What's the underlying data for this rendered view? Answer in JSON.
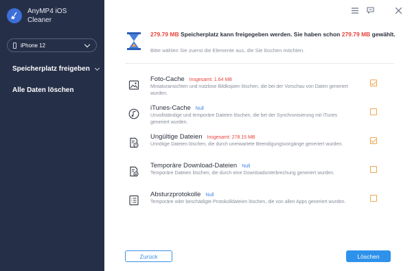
{
  "app": {
    "name": "AnyMP4 iOS Cleaner"
  },
  "device": {
    "name": "iPhone 12"
  },
  "sidebar": {
    "items": [
      {
        "label": "Speicherplatz freigeben"
      },
      {
        "label": "Alle Daten löschen"
      }
    ]
  },
  "header": {
    "size_a": "279.79 MB",
    "text_a": " Speicherplatz kann freigegeben werden. Sie haben schon ",
    "size_b": "279.79 MB",
    "text_b": " gewählt.",
    "subtitle": "Bitte wählen Sie zuerst die Elemente aus, die Sie löschen möchten."
  },
  "items": [
    {
      "title": "Foto-Cache",
      "size": "Insgesamt: 1.64 MB",
      "desc": "Miniaturansichten und nutzlose Bildkopien löschen, die bei der Vorschau von Daten generiert wurden.",
      "checked": true
    },
    {
      "title": "iTunes-Cache",
      "size": "Null",
      "desc": "Unvollständige und temporäre Dateien löschen, die bei der Synchronisierung mit iTunes generiert wurden.",
      "checked": false
    },
    {
      "title": "Ungültige Dateien",
      "size": "Insgesamt: 278.15 MB",
      "desc": "Unnötige Dateien löschen, die durch unerwartete Beendigungsvorgänge generiert wurden.",
      "checked": true
    },
    {
      "title": "Temporäre Download-Dateien",
      "size": "Null",
      "desc": "Temporäre Dateien löschen, die durch eine Downloadunterbrechung generiert wurden.",
      "checked": false
    },
    {
      "title": "Absturzprotokolle",
      "size": "Null",
      "desc": "Temporäre oder beschädigte Protokolldateien löschen, die von allen Apps generiert wurden.",
      "checked": false
    }
  ],
  "buttons": {
    "back": "Zurück",
    "delete": "Löschen"
  },
  "icons": {
    "logo": "broom-icon",
    "window": [
      "menu-icon",
      "feedback-icon",
      "close-icon"
    ]
  },
  "colors": {
    "sidebar": "#262f48",
    "accent": "#2e92ea",
    "highlight": "#e6423a",
    "checkbox": "#f0a54c"
  }
}
